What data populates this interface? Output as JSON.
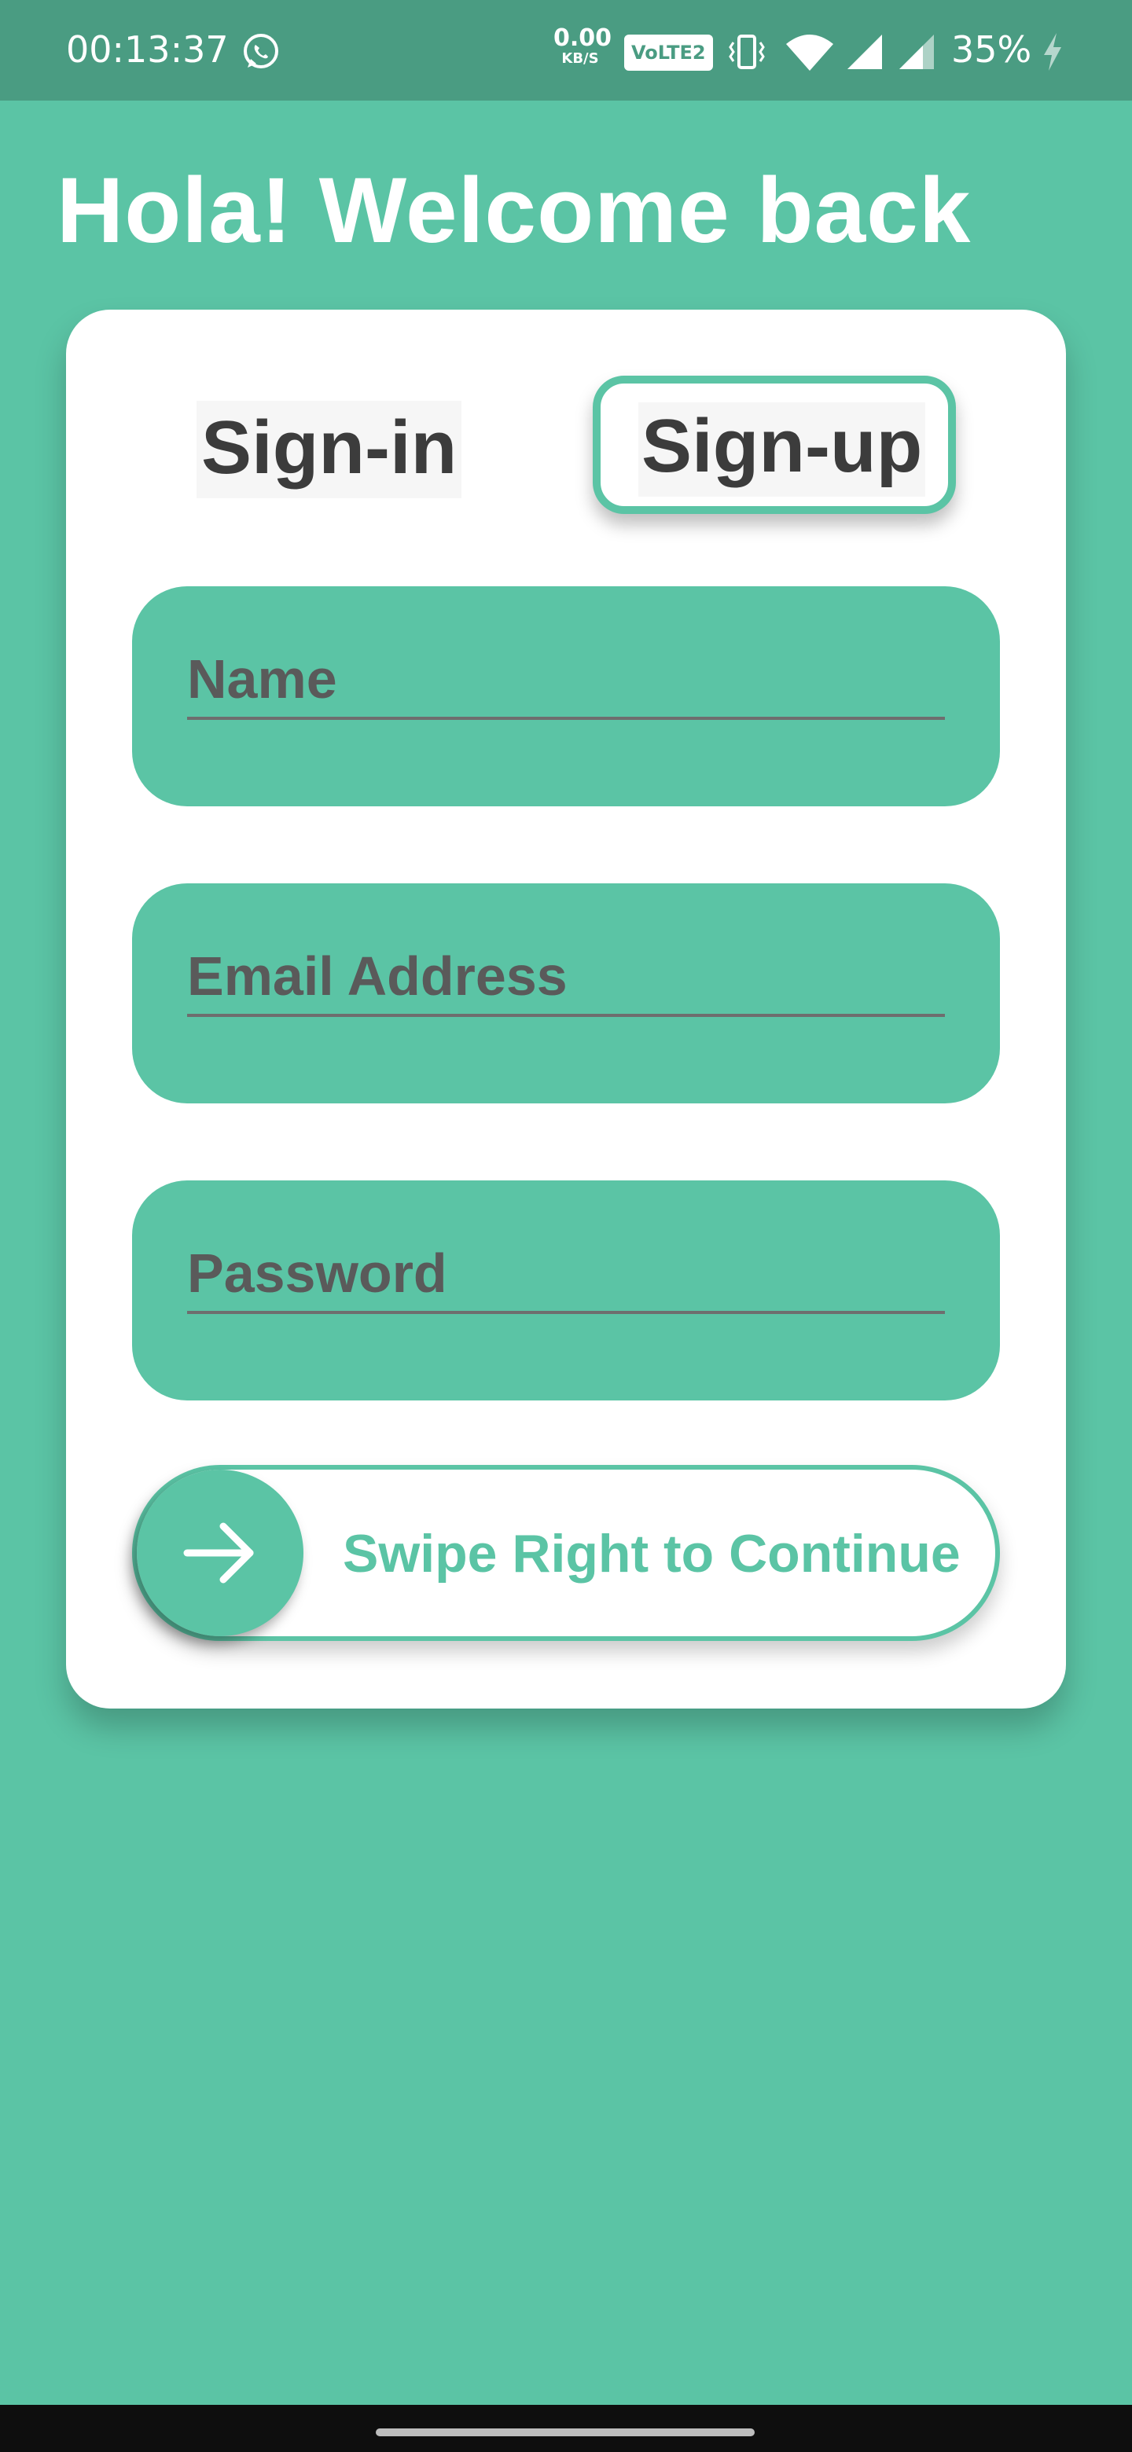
{
  "status_bar": {
    "time": "00:13:37",
    "net_speed_value": "0.00",
    "net_speed_unit": "KB/S",
    "volte_label": "VoLTE2",
    "battery_percent": "35%",
    "icons": [
      "whatsapp-icon",
      "vibrate-icon",
      "wifi-icon",
      "signal-icon",
      "signal-icon",
      "charging-icon"
    ]
  },
  "header": {
    "title": "Hola! Welcome back"
  },
  "tabs": {
    "signin_label": "Sign-in",
    "signup_label": "Sign-up",
    "active": "Sign-up"
  },
  "form": {
    "name_placeholder": "Name",
    "email_placeholder": "Email Address",
    "password_placeholder": "Password",
    "name_value": "",
    "email_value": "",
    "password_value": ""
  },
  "swipe": {
    "label": "Swipe Right to Continue",
    "handle_icon": "arrow-right-icon"
  },
  "colors": {
    "accent": "#5bc4a5",
    "status_bar": "#4a9c82",
    "card": "#ffffff",
    "text_dark": "#3c3c3c"
  }
}
